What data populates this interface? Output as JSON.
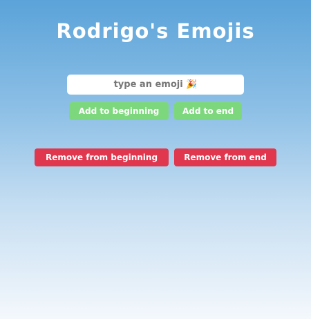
{
  "app": {
    "title": "Rodrigo's Emojis"
  },
  "input": {
    "placeholder": "type an emoji 🎉",
    "value": ""
  },
  "buttons": {
    "add_beginning": "Add to beginning",
    "add_end": "Add to end",
    "remove_beginning": "Remove from beginning",
    "remove_end": "Remove from end"
  },
  "colors": {
    "add_button": "#7dd87d",
    "remove_button": "#e0364e",
    "background_top": "#5ba3d9",
    "background_bottom": "#f4f8fc"
  }
}
